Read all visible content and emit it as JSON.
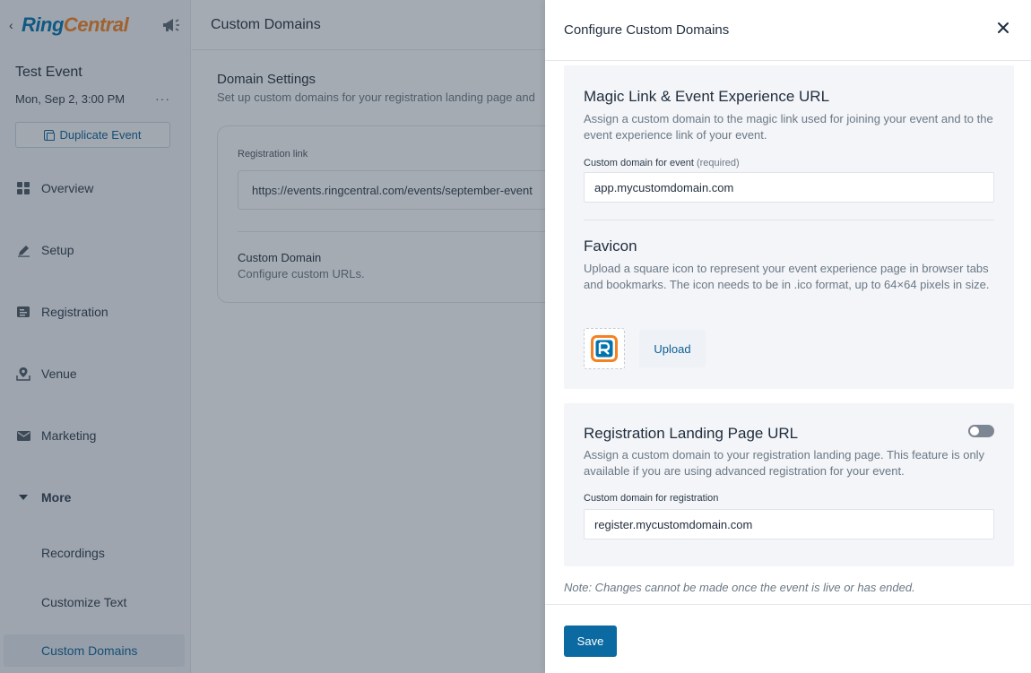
{
  "sidebar": {
    "logo": {
      "ring": "Ring",
      "central": "Central"
    },
    "event_title": "Test Event",
    "event_date": "Mon, Sep 2, 3:00 PM",
    "duplicate_label": "Duplicate Event",
    "nav": {
      "overview": "Overview",
      "setup": "Setup",
      "registration": "Registration",
      "venue": "Venue",
      "marketing": "Marketing",
      "more": "More"
    },
    "sub": {
      "recordings": "Recordings",
      "customize_text": "Customize Text",
      "custom_domains": "Custom Domains"
    }
  },
  "main": {
    "header_title": "Custom Domains",
    "section_title": "Domain Settings",
    "section_sub": "Set up custom domains for your registration landing page and",
    "registration_link_label": "Registration link",
    "registration_link_value": "https://events.ringcentral.com/events/september-event",
    "custom_domain_title": "Custom Domain",
    "custom_domain_sub": "Configure custom URLs."
  },
  "drawer": {
    "title": "Configure Custom Domains",
    "magic": {
      "title": "Magic Link & Event Experience URL",
      "desc": "Assign a custom domain to the magic link used for joining your event and to the event experience link of your event.",
      "field_label": "Custom domain for event",
      "field_required": "(required)",
      "field_value": "app.mycustomdomain.com"
    },
    "favicon": {
      "title": "Favicon",
      "desc": "Upload a square icon to represent your event experience page in browser tabs and bookmarks. The icon needs to be in .ico format, up to 64×64 pixels in size.",
      "upload_label": "Upload"
    },
    "registration": {
      "title": "Registration Landing Page URL",
      "desc": "Assign a custom domain to your registration landing page. This feature is only available if you are using advanced registration for your event.",
      "field_label": "Custom domain for registration",
      "field_value": "register.mycustomdomain.com",
      "toggle_on": false
    },
    "note": "Note: Changes cannot be made once the event is live or has ended.",
    "save_label": "Save"
  },
  "colors": {
    "accent": "#0a6aa1",
    "brand_blue": "#0073ae",
    "brand_orange": "#f58220"
  }
}
